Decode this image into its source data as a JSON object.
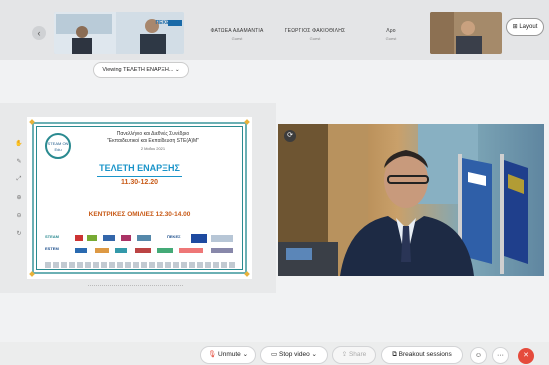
{
  "participants": [
    {
      "name": "ΦΑΤΩΕΑ ΑΔΑΜΑΝΤΙΑ",
      "sub": "Guest"
    },
    {
      "name": "ΓΕΩΡΓΙΟΣ ΦΑΚΙΟΘΙΛΗΣ",
      "sub": "Guest"
    },
    {
      "name": "Λρο",
      "sub": "Guest"
    }
  ],
  "thumb_label": "ΠΕΚΕΣ",
  "layout": {
    "label": "Layout"
  },
  "viewing_label": "Viewing ΤΕΛΕΤΗ ΕΝΑΡΞΗ...",
  "slide": {
    "logo_text": "STEAM ON Edu",
    "conf_line1": "Πανελλήνιο και Διεθνές Συνέδριο",
    "conf_line2": "\"Εκπαιδευτικοί και Εκπαίδευση STE(A)M\"",
    "conf_date": "2 Μαΐου 2021",
    "ceremony_title": "ΤΕΛΕΤΗ ΕΝΑΡΞΗΣ",
    "ceremony_time": "11.30-12.20",
    "keynote": "ΚΕΝΤΡΙΚΕΣ ΟΜΙΛΙΕΣ 12.30-14.00",
    "logos": [
      "STEAM",
      "ΠΕΚΕΣ",
      "ESTEM"
    ]
  },
  "controls": {
    "unmute": "Unmute",
    "stop_video": "Stop video",
    "share": "Share",
    "breakout": "Breakout sessions",
    "more": "···"
  },
  "colors": {
    "accent_teal": "#2a8a90",
    "title_blue": "#1a94c9",
    "time_orange": "#c85a17",
    "leave_red": "#e54b3c"
  }
}
